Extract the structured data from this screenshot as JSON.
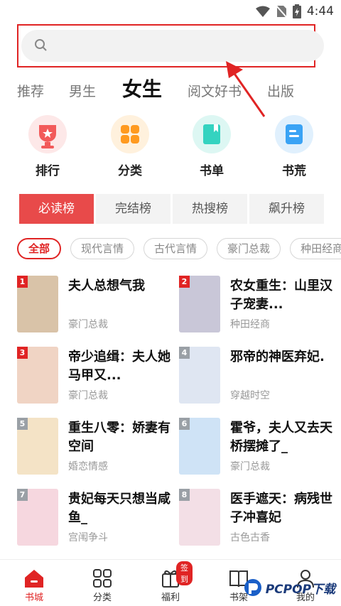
{
  "status_bar": {
    "time": "4:44"
  },
  "search": {
    "placeholder": ""
  },
  "tabs": [
    {
      "label": "推荐"
    },
    {
      "label": "男生"
    },
    {
      "label": "女生"
    },
    {
      "label": "阅文好书"
    },
    {
      "label": "出版"
    }
  ],
  "quick_links": [
    {
      "label": "排行",
      "icon": "trophy-icon",
      "color": "#f25a5a"
    },
    {
      "label": "分类",
      "icon": "grid-icon",
      "color": "#ff9a1f"
    },
    {
      "label": "书单",
      "icon": "book-icon",
      "color": "#34d3c0"
    },
    {
      "label": "书荒",
      "icon": "list-icon",
      "color": "#3aa3f5"
    }
  ],
  "rank_tabs": [
    {
      "label": "必读榜"
    },
    {
      "label": "完结榜"
    },
    {
      "label": "热搜榜"
    },
    {
      "label": "飙升榜"
    }
  ],
  "chips": [
    "全部",
    "现代言情",
    "古代言情",
    "豪门总裁",
    "种田经商"
  ],
  "books": [
    {
      "rank": "1",
      "title": "夫人总想气我",
      "tag": "豪门总裁",
      "cover_color": "#d9c3a8",
      "rank_color": "#e02424"
    },
    {
      "rank": "2",
      "title": "农女重生：山里汉子宠妻...",
      "tag": "种田经商",
      "cover_color": "#c9c7d8",
      "rank_color": "#e02424"
    },
    {
      "rank": "3",
      "title": "帝少追缉：夫人她马甲又...",
      "tag": "豪门总裁",
      "cover_color": "#f0d4c4",
      "rank_color": "#e02424"
    },
    {
      "rank": "4",
      "title": "邪帝的神医弃妃.",
      "tag": "穿越时空",
      "cover_color": "#dfe6f2",
      "rank_color": "#9aa0a6"
    },
    {
      "rank": "5",
      "title": "重生八零：娇妻有空间",
      "tag": "婚恋情感",
      "cover_color": "#f4e3c6",
      "rank_color": "#9aa0a6"
    },
    {
      "rank": "6",
      "title": "霍爷，夫人又去天桥摆摊了_",
      "tag": "豪门总裁",
      "cover_color": "#cfe3f6",
      "rank_color": "#9aa0a6"
    },
    {
      "rank": "7",
      "title": "贵妃每天只想当咸鱼_",
      "tag": "宫闱争斗",
      "cover_color": "#f6d7df",
      "rank_color": "#9aa0a6"
    },
    {
      "rank": "8",
      "title": "医手遮天：病残世子冲喜妃",
      "tag": "古色古香",
      "cover_color": "#f3dfe6",
      "rank_color": "#9aa0a6"
    }
  ],
  "bottom_nav": [
    {
      "label": "书城",
      "icon": "home-icon"
    },
    {
      "label": "分类",
      "icon": "category-icon"
    },
    {
      "label": "福利",
      "icon": "gift-icon",
      "badge": "签到"
    },
    {
      "label": "书架",
      "icon": "bookshelf-icon"
    },
    {
      "label": "我的",
      "icon": "profile-icon"
    }
  ],
  "watermark": {
    "text": "PCPOP下载"
  },
  "colors": {
    "accent": "#e02424",
    "annotation": "#e02424"
  }
}
